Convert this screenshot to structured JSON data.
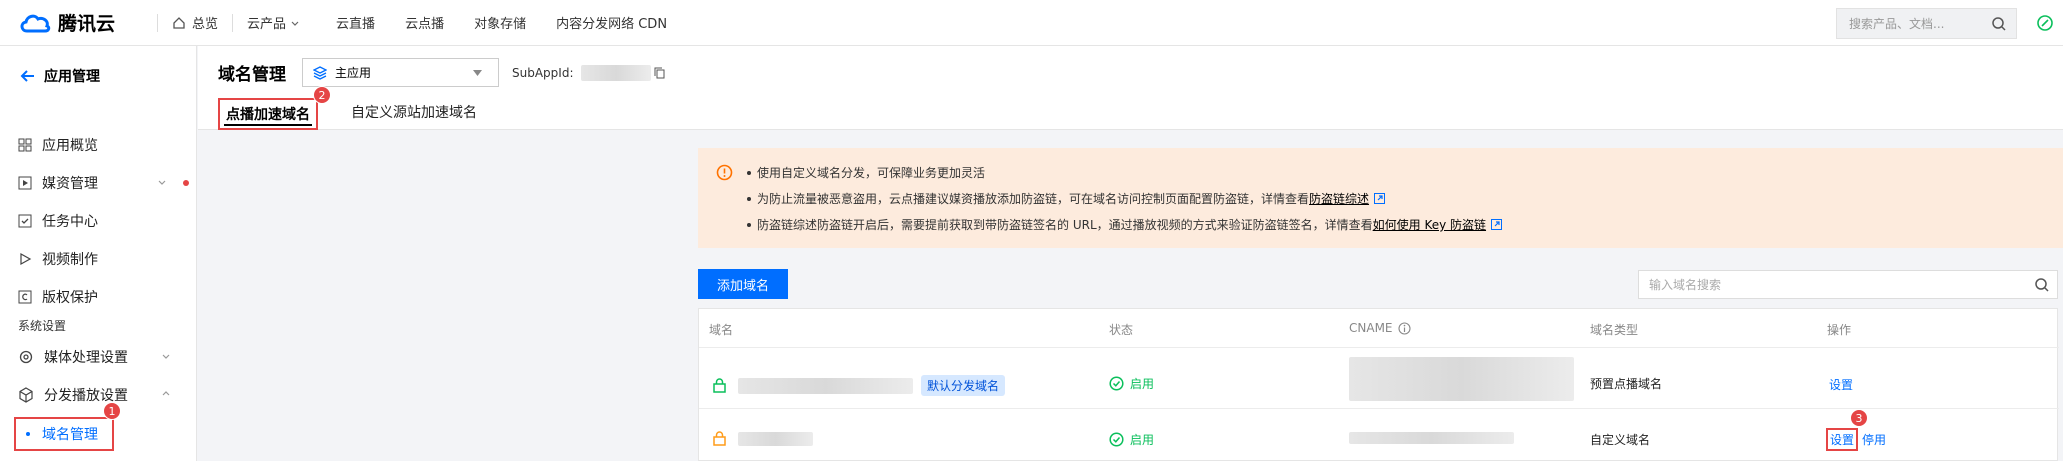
{
  "topbar": {
    "brand": "腾讯云",
    "nav": [
      "总览",
      "云产品",
      "云直播",
      "云点播",
      "对象存储",
      "内容分发网络 CDN"
    ],
    "search_placeholder": "搜索产品、文档..."
  },
  "sidebar": {
    "title": "应用管理",
    "items": [
      {
        "label": "应用概览",
        "icon": "grid-icon"
      },
      {
        "label": "媒资管理",
        "icon": "media-icon"
      },
      {
        "label": "任务中心",
        "icon": "checkbox-icon"
      },
      {
        "label": "视频制作",
        "icon": "play-icon"
      },
      {
        "label": "版权保护",
        "icon": "copyright-icon"
      }
    ],
    "group_label": "系统设置",
    "settings": [
      {
        "label": "媒体处理设置",
        "icon": "gear-icon"
      },
      {
        "label": "分发播放设置",
        "icon": "cube-icon"
      }
    ],
    "active_item": "域名管理"
  },
  "page": {
    "title": "域名管理",
    "app_select": "主应用",
    "subappid_label": "SubAppId:",
    "tabs": [
      "点播加速域名",
      "自定义源站加速域名"
    ]
  },
  "alert": {
    "lines": [
      {
        "text": "使用自定义域名分发，可保障业务更加灵活",
        "link": ""
      },
      {
        "text": "为防止流量被恶意盗用，云点播建议媒资播放添加防盗链，可在域名访问控制页面配置防盗链，详情查看",
        "link": "防盗链综述"
      },
      {
        "text": "防盗链综述防盗链开启后，需要提前获取到带防盗链签名的 URL，通过播放视频的方式来验证防盗链签名，详情查看",
        "link": "如何使用 Key 防盗链"
      }
    ]
  },
  "toolbar": {
    "add_label": "添加域名",
    "search_placeholder": "输入域名搜索"
  },
  "table": {
    "columns": [
      "域名",
      "状态",
      "CNAME",
      "域名类型",
      "操作"
    ],
    "rows": [
      {
        "tag": "默认分发域名",
        "status": "启用",
        "type": "预置点播域名",
        "actions": [
          "设置"
        ],
        "lock_color": "#0abf5b"
      },
      {
        "tag": "",
        "status": "启用",
        "type": "自定义域名",
        "actions": [
          "设置",
          "停用"
        ],
        "lock_color": "#ff9c19"
      }
    ]
  },
  "badges": [
    "1",
    "2",
    "3"
  ],
  "colors": {
    "primary": "#006eff",
    "highlight": "#e54545",
    "success": "#0abf5b",
    "alert_bg": "#fdebdd"
  }
}
